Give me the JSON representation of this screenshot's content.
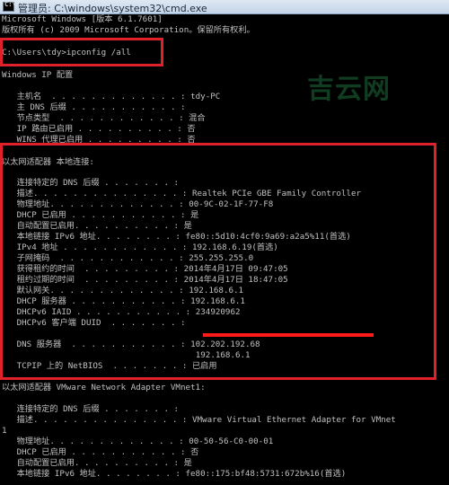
{
  "window": {
    "title": "管理员: C:\\windows\\system32\\cmd.exe",
    "icon": "console-icon",
    "icon_glyph": "C:\\"
  },
  "lines": [
    {
      "t": "Microsoft Windows [版本 6.1.7601]"
    },
    {
      "t": "版权所有 (c) 2009 Microsoft Corporation。保留所有权利。"
    },
    {
      "t": ""
    },
    {
      "t": "C:\\Users\\tdy>ipconfig /all"
    },
    {
      "t": ""
    },
    {
      "t": "Windows IP 配置"
    },
    {
      "t": ""
    },
    {
      "t": "   主机名  . . . . . . . . . . . . . : tdy-PC"
    },
    {
      "t": "   主 DNS 后缀 . . . . . . . . . . . :"
    },
    {
      "t": "   节点类型  . . . . . . . . . . . . : 混合"
    },
    {
      "t": "   IP 路由已启用 . . . . . . . . . . : 否"
    },
    {
      "t": "   WINS 代理已启用 . . . . . . . . . : 否"
    },
    {
      "t": ""
    },
    {
      "t": "以太网适配器 本地连接:"
    },
    {
      "t": ""
    },
    {
      "t": "   连接特定的 DNS 后缀 . . . . . . . :"
    },
    {
      "t": "   描述. . . . . . . . . . . . . . . : Realtek PCIe GBE Family Controller"
    },
    {
      "t": "   物理地址. . . . . . . . . . . . . : 00-9C-02-1F-77-F8"
    },
    {
      "t": "   DHCP 已启用 . . . . . . . . . . . : 是"
    },
    {
      "t": "   自动配置已启用. . . . . . . . . . : 是"
    },
    {
      "t": "   本地链接 IPv6 地址. . . . . . . . : fe80::5d10:4cf0:9a69:a2a5%11(首选)"
    },
    {
      "t": "   IPv4 地址 . . . . . . . . . . . . : 192.168.6.19(首选)"
    },
    {
      "t": "   子网掩码  . . . . . . . . . . . . : 255.255.255.0"
    },
    {
      "t": "   获得租约的时间  . . . . . . . . . : 2014年4月17日 09:47:05"
    },
    {
      "t": "   租约过期的时间  . . . . . . . . . : 2014年4月17日 18:47:05"
    },
    {
      "t": "   默认网关. . . . . . . . . . . . . : 192.168.6.1"
    },
    {
      "t": "   DHCP 服务器 . . . . . . . . . . . : 192.168.6.1"
    },
    {
      "t": "   DHCPv6 IAID . . . . . . . . . . . : 234920962"
    },
    {
      "t": "   DHCPv6 客户端 DUID  . . . . . . . :"
    },
    {
      "t": ""
    },
    {
      "t": "   DNS 服务器  . . . . . . . . . . . : 102.202.192.68"
    },
    {
      "t": "                                       192.168.6.1"
    },
    {
      "t": "   TCPIP 上的 NetBIOS  . . . . . . . : 已启用"
    },
    {
      "t": ""
    },
    {
      "t": "以太网适配器 VMware Network Adapter VMnet1:"
    },
    {
      "t": ""
    },
    {
      "t": "   连接特定的 DNS 后缀 . . . . . . . :"
    },
    {
      "t": "   描述. . . . . . . . . . . . . . . : VMware Virtual Ethernet Adapter for VMnet"
    },
    {
      "t": "1"
    },
    {
      "t": "   物理地址. . . . . . . . . . . . . : 00-50-56-C0-00-01"
    },
    {
      "t": "   DHCP 已启用 . . . . . . . . . . . : 否"
    },
    {
      "t": "   自动配置已启用. . . . . . . . . . : 是"
    },
    {
      "t": "   本地链接 IPv6 地址. . . . . . . . : fe80::175:bf48:5731:672b%16(首选)"
    }
  ],
  "watermark": {
    "text": "吉云网"
  },
  "colors": {
    "text": "#c0c0c0",
    "background": "#000000",
    "annotation": "#e0212b"
  }
}
